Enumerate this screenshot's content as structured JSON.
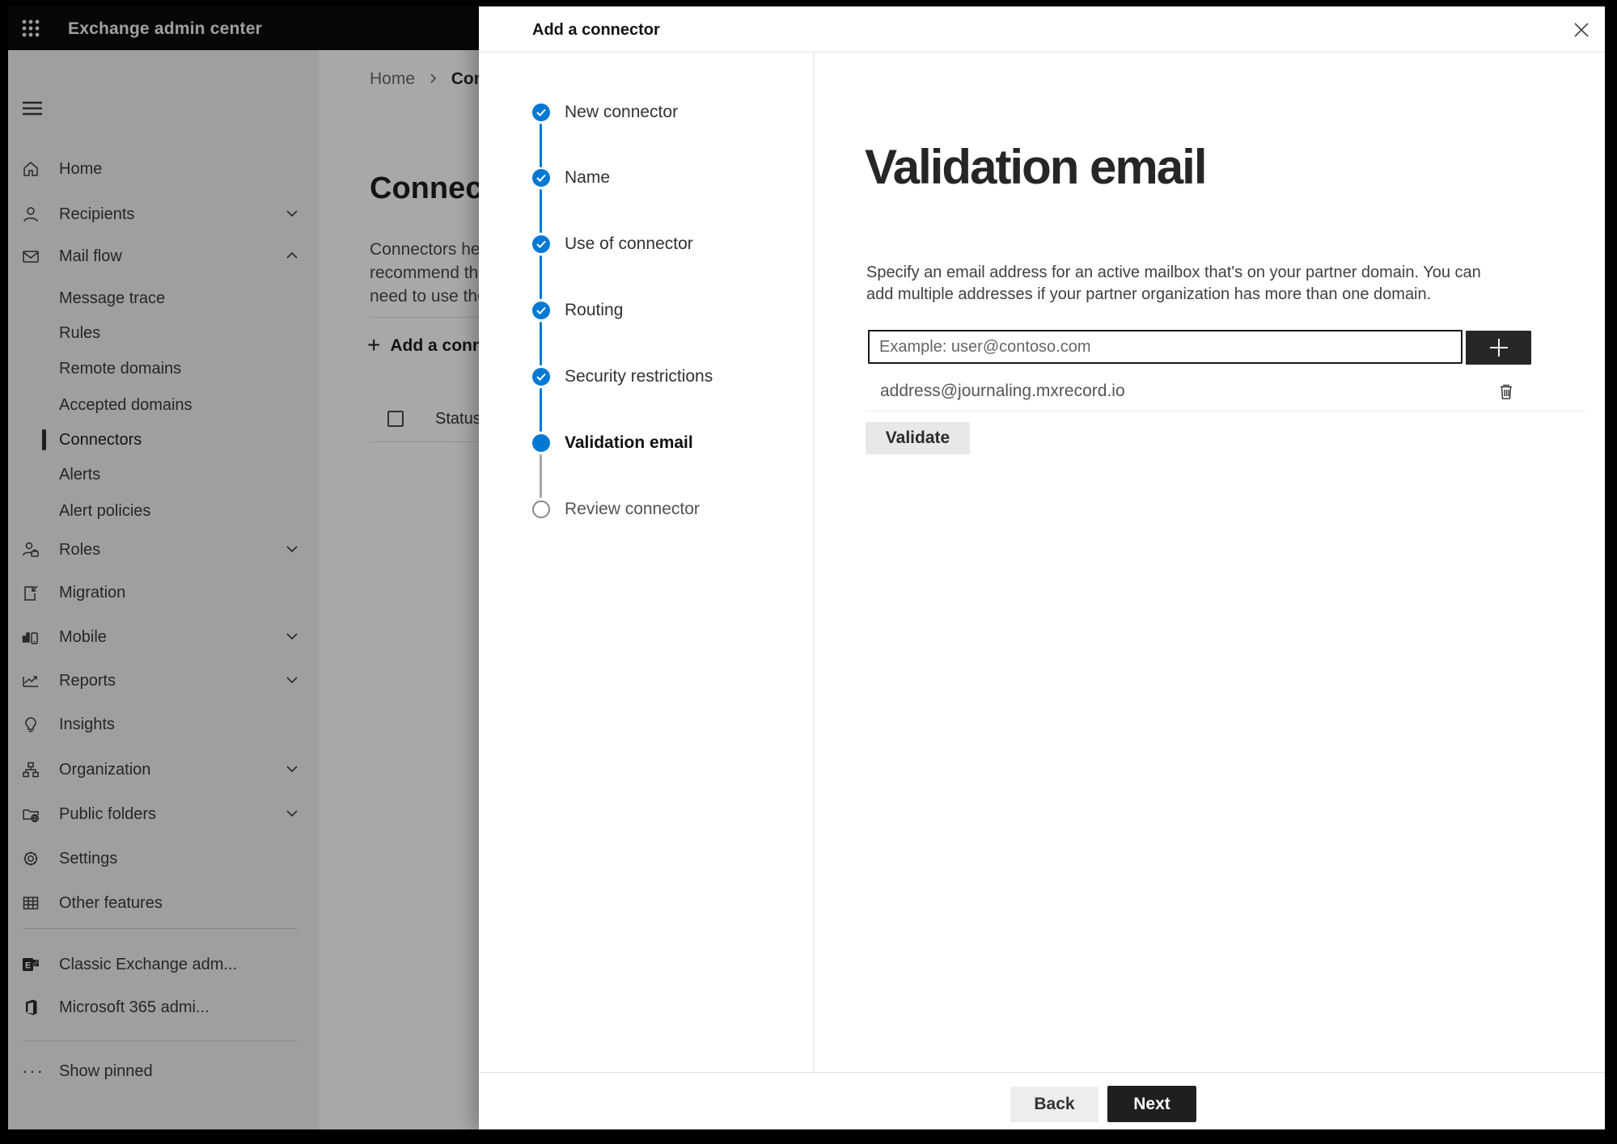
{
  "topbar": {
    "title": "Exchange admin center"
  },
  "sidebar": {
    "items": [
      {
        "label": "Home"
      },
      {
        "label": "Recipients"
      },
      {
        "label": "Mail flow"
      },
      {
        "label": "Message trace"
      },
      {
        "label": "Rules"
      },
      {
        "label": "Remote domains"
      },
      {
        "label": "Accepted domains"
      },
      {
        "label": "Connectors"
      },
      {
        "label": "Alerts"
      },
      {
        "label": "Alert policies"
      },
      {
        "label": "Roles"
      },
      {
        "label": "Migration"
      },
      {
        "label": "Mobile"
      },
      {
        "label": "Reports"
      },
      {
        "label": "Insights"
      },
      {
        "label": "Organization"
      },
      {
        "label": "Public folders"
      },
      {
        "label": "Settings"
      },
      {
        "label": "Other features"
      },
      {
        "label": "Classic Exchange adm..."
      },
      {
        "label": "Microsoft 365 admi..."
      },
      {
        "label": "Show pinned"
      }
    ]
  },
  "page": {
    "breadcrumb": {
      "home": "Home",
      "current": "Conne"
    },
    "title": "Connec",
    "description_lines": [
      "Connectors help",
      "recommend tha",
      "need to use ther"
    ],
    "add_connector_button": "Add a conn",
    "status_header": "Status"
  },
  "dialog": {
    "title": "Add a connector",
    "steps": [
      {
        "label": "New connector",
        "state": "complete"
      },
      {
        "label": "Name",
        "state": "complete"
      },
      {
        "label": "Use of connector",
        "state": "complete"
      },
      {
        "label": "Routing",
        "state": "complete"
      },
      {
        "label": "Security restrictions",
        "state": "complete"
      },
      {
        "label": "Validation email",
        "state": "current"
      },
      {
        "label": "Review connector",
        "state": "upcoming"
      }
    ],
    "content": {
      "heading": "Validation email",
      "description": "Specify an email address for an active mailbox that's on your partner domain. You can add multiple addresses if your partner organization has more than one domain.",
      "email_input_placeholder": "Example: user@contoso.com",
      "added_emails": [
        "address@journaling.mxrecord.io"
      ],
      "validate_button": "Validate"
    },
    "footer": {
      "back_button": "Back",
      "next_button": "Next"
    }
  },
  "colors": {
    "accent": "#0078d4",
    "topbar": "#0b0b0b",
    "dark_button": "#1f1f1f"
  }
}
